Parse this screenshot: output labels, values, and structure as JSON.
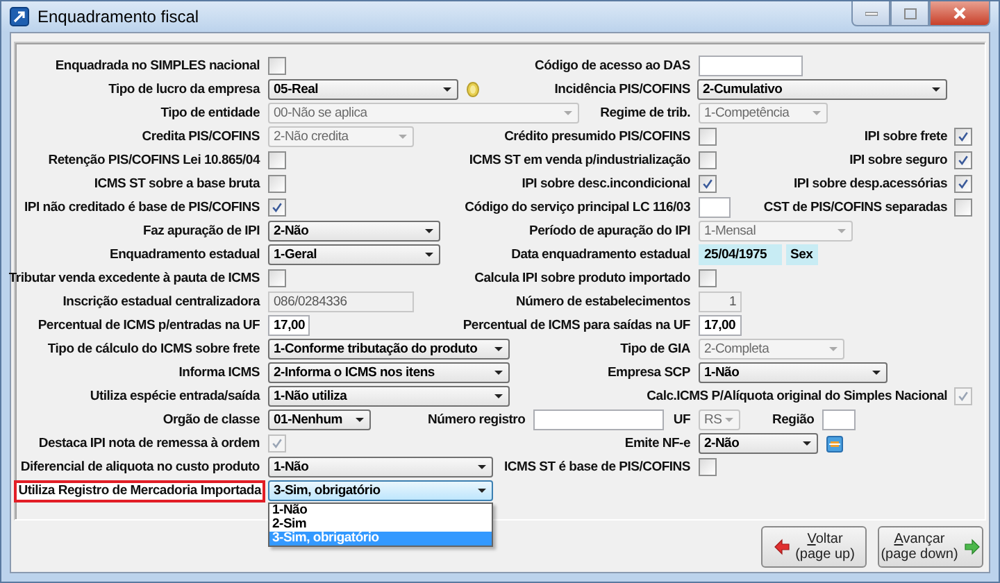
{
  "window": {
    "title": "Enquadramento fiscal"
  },
  "rows": [
    {
      "left": {
        "label": "Enquadrada no SIMPLES nacional",
        "control": {
          "kind": "checkbox",
          "checked": false,
          "disabled": false
        }
      },
      "middle": {
        "label": "Código de acesso ao DAS",
        "control": {
          "kind": "field",
          "disabled": false
        }
      }
    },
    {
      "left": {
        "label": "Tipo de lucro da empresa",
        "control": {
          "kind": "select",
          "value": "05-Real",
          "disabled": false
        }
      },
      "middle": {
        "label": "Incidência PIS/COFINS",
        "control": {
          "kind": "select",
          "value": "2-Cumulativo",
          "disabled": false
        }
      }
    },
    {
      "left": {
        "label": "Tipo de entidade",
        "control": {
          "kind": "select",
          "value": "00-Não se aplica",
          "disabled": true
        }
      },
      "middle": {
        "label": "Regime de trib.",
        "control": {
          "kind": "select",
          "value": "1-Competência",
          "disabled": true
        }
      }
    },
    {
      "left": {
        "label": "Credita PIS/COFINS",
        "control": {
          "kind": "select",
          "value": "2-Não credita",
          "disabled": true
        }
      },
      "middle": {
        "label": "Crédito presumido PIS/COFINS",
        "control": {
          "kind": "checkbox",
          "checked": false,
          "disabled": false
        }
      },
      "right": {
        "label": "IPI sobre frete",
        "control": {
          "kind": "checkbox",
          "checked": true,
          "disabled": false
        }
      }
    },
    {
      "left": {
        "label": "Retenção PIS/COFINS Lei 10.865/04",
        "control": {
          "kind": "checkbox",
          "checked": false,
          "disabled": false
        }
      },
      "middle": {
        "label": "ICMS ST em venda p/industrialização",
        "control": {
          "kind": "checkbox",
          "checked": false,
          "disabled": false
        }
      },
      "right": {
        "label": "IPI sobre seguro",
        "control": {
          "kind": "checkbox",
          "checked": true,
          "disabled": false
        }
      }
    },
    {
      "left": {
        "label": "ICMS ST sobre a base bruta",
        "control": {
          "kind": "checkbox",
          "checked": false,
          "disabled": false
        }
      },
      "middle": {
        "label": "IPI sobre desc.incondicional",
        "control": {
          "kind": "checkbox",
          "checked": true,
          "disabled": false
        }
      },
      "right": {
        "label": "IPI sobre desp.acessórias",
        "control": {
          "kind": "checkbox",
          "checked": true,
          "disabled": false
        }
      }
    },
    {
      "left": {
        "label": "IPI não creditado é base de PIS/COFINS",
        "control": {
          "kind": "checkbox",
          "checked": true,
          "disabled": false
        }
      },
      "middle": {
        "label": "Código do serviço principal LC 116/03",
        "control": {
          "kind": "field",
          "disabled": false
        }
      },
      "right": {
        "label": "CST de PIS/COFINS separadas",
        "control": {
          "kind": "checkbox",
          "checked": false,
          "disabled": false
        }
      }
    },
    {
      "left": {
        "label": "Faz apuração de IPI",
        "control": {
          "kind": "select",
          "value": "2-Não",
          "disabled": false
        }
      },
      "middle": {
        "label": "Período de apuração do IPI",
        "control": {
          "kind": "select",
          "value": "1-Mensal",
          "disabled": true
        }
      }
    },
    {
      "left": {
        "label": "Enquadramento estadual",
        "control": {
          "kind": "select",
          "value": "1-Geral",
          "disabled": false
        }
      },
      "middle": {
        "label": "Data enquadramento estadual",
        "control": {
          "kind": "date",
          "value": "25/04/1975",
          "weekday": "Sex"
        }
      }
    },
    {
      "left": {
        "label": "Tributar venda excedente à pauta de ICMS",
        "control": {
          "kind": "checkbox",
          "checked": false,
          "disabled": false
        }
      },
      "middle": {
        "label": "Calcula IPI sobre produto importado",
        "control": {
          "kind": "checkbox",
          "checked": false,
          "disabled": false
        }
      }
    },
    {
      "left": {
        "label": "Inscrição estadual centralizadora",
        "control": {
          "kind": "field",
          "value": "086/0284336",
          "disabled": true
        }
      },
      "middle": {
        "label": "Número de estabelecimentos",
        "control": {
          "kind": "field",
          "value": "1",
          "disabled": true
        }
      }
    },
    {
      "left": {
        "label": "Percentual de ICMS p/entradas na UF",
        "control": {
          "kind": "field",
          "value": "17,00",
          "disabled": false
        }
      },
      "middle": {
        "label": "Percentual de ICMS para saídas na UF",
        "control": {
          "kind": "field",
          "value": "17,00",
          "disabled": false
        }
      }
    },
    {
      "left": {
        "label": "Tipo de cálculo do ICMS sobre frete",
        "control": {
          "kind": "select",
          "value": "1-Conforme tributação do produto",
          "disabled": false
        }
      },
      "middle": {
        "label": "Tipo de GIA",
        "control": {
          "kind": "select",
          "value": "2-Completa",
          "disabled": true
        }
      }
    },
    {
      "left": {
        "label": "Informa ICMS",
        "control": {
          "kind": "select",
          "value": "2-Informa o ICMS nos itens",
          "disabled": false
        }
      },
      "middle": {
        "label": "Empresa SCP",
        "control": {
          "kind": "select",
          "value": "1-Não",
          "disabled": false
        }
      }
    },
    {
      "left": {
        "label": "Utiliza espécie entrada/saída",
        "control": {
          "kind": "select",
          "value": "1-Não utiliza",
          "disabled": false
        }
      },
      "right": {
        "label": "Calc.ICMS P/Alíquota original do Simples Nacional",
        "control": {
          "kind": "checkbox",
          "checked": true,
          "disabled": true
        }
      }
    },
    {
      "left": {
        "label": "Orgão de classe",
        "control": {
          "kind": "select",
          "value": "01-Nenhum",
          "disabled": false
        },
        "extra": {
          "label": "Número registro",
          "control": {
            "kind": "field",
            "disabled": false
          }
        }
      },
      "middle": {
        "label": "UF",
        "control": {
          "kind": "select",
          "value": "RS",
          "disabled": true
        },
        "extra": {
          "label": "Região",
          "control": {
            "kind": "field",
            "disabled": false
          }
        }
      }
    },
    {
      "left": {
        "label": "Destaca IPI nota de remessa à ordem",
        "control": {
          "kind": "checkbox",
          "checked": true,
          "disabled": true
        }
      },
      "middle": {
        "label": "Emite NF-e",
        "control": {
          "kind": "select",
          "value": "2-Não",
          "disabled": false
        }
      }
    },
    {
      "left": {
        "label": "Diferencial de aliquota no custo produto",
        "control": {
          "kind": "select",
          "value": "1-Não",
          "disabled": false
        }
      },
      "middle": {
        "label": "ICMS ST é base de PIS/COFINS",
        "control": {
          "kind": "checkbox",
          "checked": false,
          "disabled": false
        }
      }
    },
    {
      "left": {
        "label": "Utiliza Registro de Mercadoria Importada",
        "highlighted": true,
        "control": {
          "kind": "select",
          "value": "3-Sim, obrigatório",
          "disabled": false,
          "expanded": true,
          "options": [
            {
              "label": "1-Não",
              "selected": false
            },
            {
              "label": "2-Sim",
              "selected": false
            },
            {
              "label": "3-Sim, obrigatório",
              "selected": true
            }
          ]
        }
      }
    }
  ],
  "buttons": [
    {
      "kind": "back",
      "lines": [
        "Voltar",
        "(page up)"
      ]
    },
    {
      "kind": "next",
      "lines": [
        "Avançar",
        "(page down)"
      ]
    }
  ]
}
